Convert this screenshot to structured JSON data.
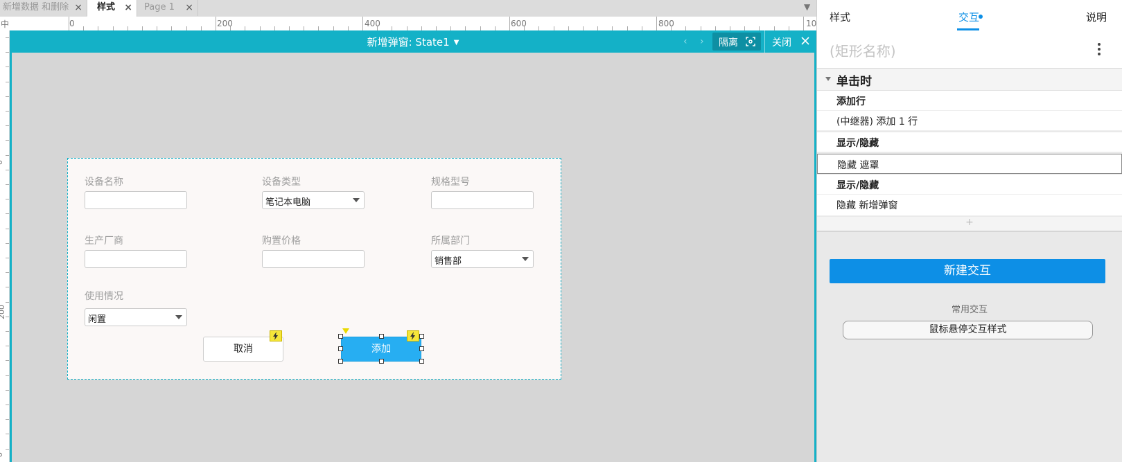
{
  "tabs": [
    {
      "label": "新增数据 和删除",
      "close": "×"
    },
    {
      "label": "样式",
      "close": "×"
    },
    {
      "label": "Page 1",
      "close": "×"
    }
  ],
  "ruler": {
    "corner": "中",
    "labels": [
      "0",
      "200",
      "400",
      "600",
      "800",
      "10"
    ],
    "vlabels": [
      "0",
      "200",
      "0"
    ]
  },
  "panel_state": {
    "title": "新增弹窗: State1",
    "prev": "‹",
    "next": "›",
    "isolate": "隔离",
    "close": "关闭"
  },
  "form": {
    "fields": [
      {
        "label": "设备名称",
        "type": "text",
        "value": ""
      },
      {
        "label": "设备类型",
        "type": "select",
        "value": "笔记本电脑"
      },
      {
        "label": "规格型号",
        "type": "text",
        "value": ""
      },
      {
        "label": "生产厂商",
        "type": "text",
        "value": ""
      },
      {
        "label": "购置价格",
        "type": "text",
        "value": ""
      },
      {
        "label": "所属部门",
        "type": "select",
        "value": "销售部"
      },
      {
        "label": "使用情况",
        "type": "select",
        "value": "闲置"
      }
    ],
    "cancel_label": "取消",
    "add_label": "添加"
  },
  "inspector": {
    "tabs": [
      "样式",
      "交互",
      "说明"
    ],
    "active_tab": "交互",
    "name_placeholder": "(矩形名称)",
    "event": "单击时",
    "actions": [
      {
        "label": "添加行",
        "bold": true
      },
      {
        "label": "(中继器) 添加 1 行",
        "bold": false
      },
      {
        "label": "显示/隐藏",
        "bold": true
      },
      {
        "label": "隐藏 遮罩",
        "bold": false,
        "selected": true
      },
      {
        "label": "显示/隐藏",
        "bold": true
      },
      {
        "label": "隐藏 新增弹窗",
        "bold": false
      }
    ],
    "add_action": "+",
    "new_interaction": "新建交互",
    "common_label": "常用交互",
    "hover_style": "鼠标悬停交互样式"
  },
  "colors": {
    "accent": "#14b1c7",
    "primary": "#0d8fe6",
    "button": "#27aef2",
    "bolt": "#f5e63a"
  }
}
